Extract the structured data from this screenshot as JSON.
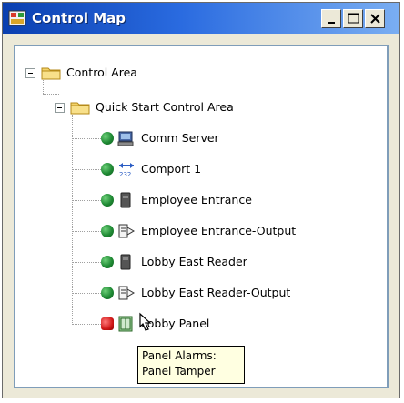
{
  "window": {
    "title": "Control Map",
    "controls": {
      "minimize": "minimize",
      "maximize": "maximize",
      "close": "close"
    }
  },
  "tree": {
    "root": {
      "label": "Control Area",
      "icon": "folder-icon"
    },
    "child": {
      "label": "Quick Start Control Area",
      "icon": "folder-icon"
    },
    "items": [
      {
        "label": "Comm Server",
        "status": "online",
        "icon": "server-icon"
      },
      {
        "label": "Comport 1",
        "status": "online",
        "icon": "comport-icon"
      },
      {
        "label": "Employee Entrance",
        "status": "online",
        "icon": "reader-icon"
      },
      {
        "label": "Employee Entrance-Output",
        "status": "online",
        "icon": "output-icon"
      },
      {
        "label": "Lobby East Reader",
        "status": "online",
        "icon": "reader-icon"
      },
      {
        "label": "Lobby East Reader-Output",
        "status": "online",
        "icon": "output-icon"
      },
      {
        "label": "Lobby Panel",
        "status": "alarm",
        "icon": "panel-icon"
      }
    ]
  },
  "tooltip": {
    "line1": "Panel Alarms:",
    "line2": "Panel Tamper"
  },
  "colors": {
    "online": "#1f8a34",
    "alarm": "#d01818",
    "titlebar": "#0a3fb0"
  }
}
